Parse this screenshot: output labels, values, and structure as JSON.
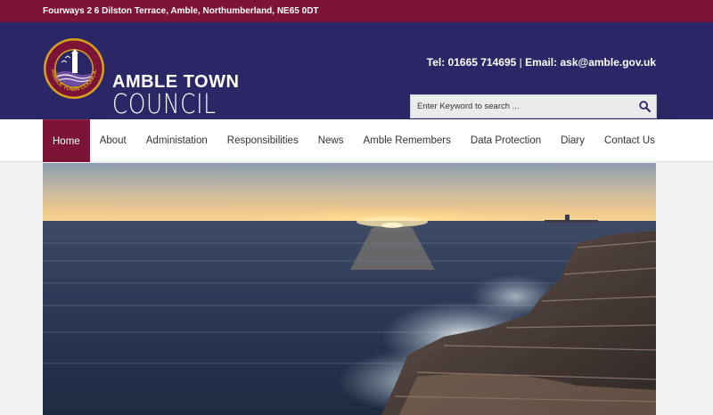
{
  "topbar": {
    "address": "Fourways 2 6 Dilston Terrace, Amble, Northumberland, NE65 0DT"
  },
  "header": {
    "logo_line1": "AMBLE TOWN",
    "logo_line2": "COUNCIL",
    "badge_text": "AMBLE TOWN COUNCIL",
    "contact": {
      "tel_label": "Tel:",
      "tel": "01665 714695",
      "sep": "|",
      "email_label": "Email:",
      "email": "ask@amble.gov.uk"
    },
    "search": {
      "placeholder": "Enter Keyword to search ...",
      "icon": "search-icon"
    }
  },
  "nav": {
    "items": [
      {
        "label": "Home",
        "active": true
      },
      {
        "label": "About"
      },
      {
        "label": "Administation"
      },
      {
        "label": "Responsibilities"
      },
      {
        "label": "News"
      },
      {
        "label": "Amble Remembers"
      },
      {
        "label": "Data Protection"
      },
      {
        "label": "Diary"
      },
      {
        "label": "Contact Us"
      }
    ]
  },
  "colors": {
    "topbar": "#7b1437",
    "header": "#2b2766",
    "nav_active": "#7b1437"
  }
}
